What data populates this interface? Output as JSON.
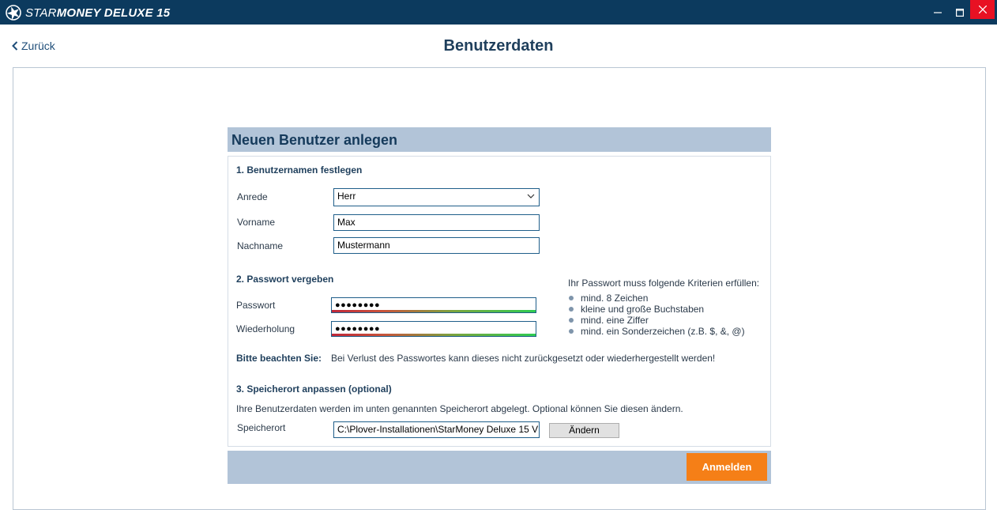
{
  "app": {
    "title_prefix": "STAR",
    "title_bold": "MONEY",
    "title_suffix": " DELUXE 15"
  },
  "nav": {
    "back_label": "Zurück",
    "page_title": "Benutzerdaten"
  },
  "card": {
    "header": "Neuen Benutzer anlegen",
    "section1_title": "1. Benutzernamen festlegen",
    "salutation_label": "Anrede",
    "salutation_value": "Herr",
    "firstname_label": "Vorname",
    "firstname_value": "Max",
    "lastname_label": "Nachname",
    "lastname_value": "Mustermann",
    "section2_title": "2. Passwort vergeben",
    "password_label": "Passwort",
    "password_value": "●●●●●●●●",
    "repeat_label": "Wiederholung",
    "repeat_value": "●●●●●●●●",
    "criteria_title": "Ihr Passwort muss folgende Kriterien erfüllen:",
    "criteria": [
      "mind. 8 Zeichen",
      "kleine und große Buchstaben",
      "mind. eine Ziffer",
      "mind. ein Sonderzeichen (z.B. $, &, @)"
    ],
    "note_label": "Bitte beachten Sie:",
    "note_text": "Bei Verlust des Passwortes kann dieses nicht zurückgesetzt oder wiederhergestellt werden!",
    "section3_title": "3. Speicherort anpassen (optional)",
    "storage_info": "Ihre Benutzerdaten werden im unten genannten Speicherort abgelegt. Optional können Sie diesen ändern.",
    "storage_label": "Speicherort",
    "storage_value": "C:\\Plover-Installationen\\StarMoney Deluxe 15 V",
    "change_button": "Ändern",
    "submit_button": "Anmelden"
  },
  "colors": {
    "titlebar": "#0c3a5e",
    "card_header": "#b2c4d8",
    "accent_button": "#f57f17",
    "close_button": "#e81123"
  }
}
